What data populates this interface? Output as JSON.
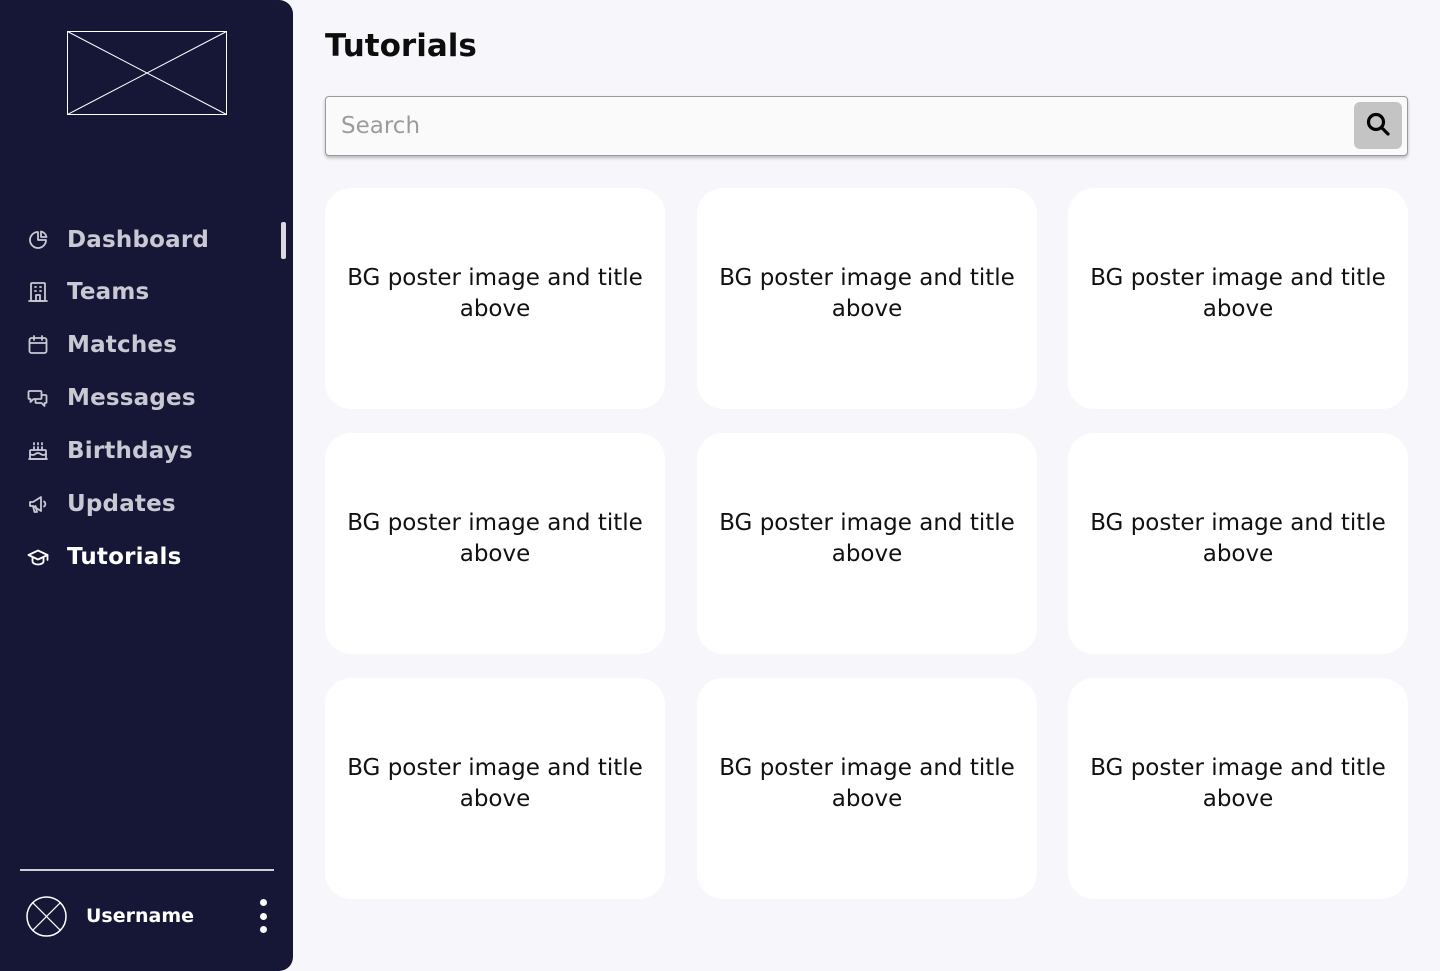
{
  "sidebar": {
    "logo_icon": "placeholder-image-icon",
    "nav": [
      {
        "label": "Dashboard",
        "icon": "pie-chart-icon",
        "active": false
      },
      {
        "label": "Teams",
        "icon": "building-icon",
        "active": false
      },
      {
        "label": "Matches",
        "icon": "calendar-icon",
        "active": false
      },
      {
        "label": "Messages",
        "icon": "chat-bubbles-icon",
        "active": false
      },
      {
        "label": "Birthdays",
        "icon": "cake-icon",
        "active": false
      },
      {
        "label": "Updates",
        "icon": "megaphone-icon",
        "active": false
      },
      {
        "label": "Tutorials",
        "icon": "graduation-cap-icon",
        "active": true
      }
    ],
    "user": {
      "name": "Username",
      "avatar_icon": "avatar-placeholder-icon",
      "menu_icon": "kebab-menu-icon"
    }
  },
  "main": {
    "title": "Tutorials",
    "search": {
      "placeholder": "Search",
      "value": "",
      "icon": "search-icon"
    },
    "cards": [
      {
        "text": "BG poster image and title above"
      },
      {
        "text": "BG poster image and title above"
      },
      {
        "text": "BG poster image and title above"
      },
      {
        "text": "BG poster image and title above"
      },
      {
        "text": "BG poster image and title above"
      },
      {
        "text": "BG poster image and title above"
      },
      {
        "text": "BG poster image and title above"
      },
      {
        "text": "BG poster image and title above"
      },
      {
        "text": "BG poster image and title above"
      }
    ]
  },
  "colors": {
    "sidebar_bg": "#161737",
    "page_bg": "#f6f6fb",
    "card_bg": "#ffffff",
    "nav_inactive": "#c9c9d3",
    "nav_active": "#ffffff",
    "search_button_bg": "#c4c4c4"
  }
}
